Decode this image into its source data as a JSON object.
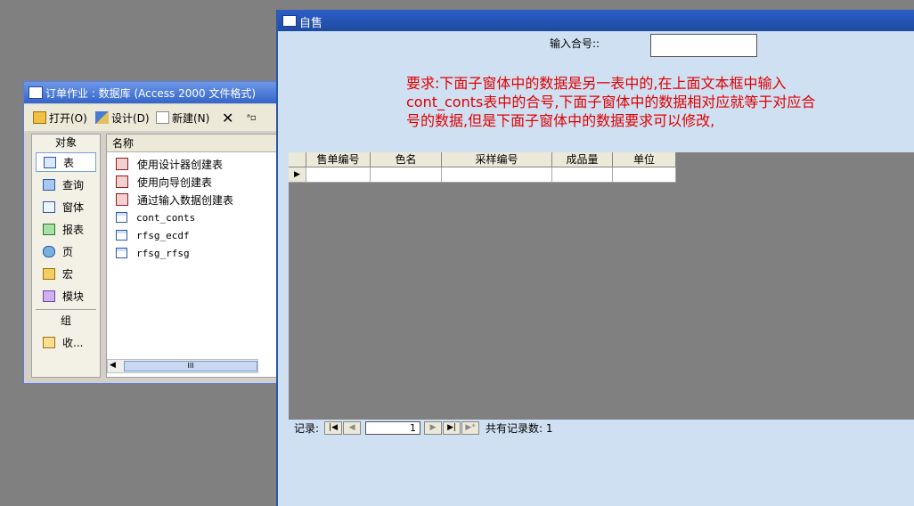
{
  "db_window": {
    "title": "订单作业 : 数据库 (Access 2000 文件格式)",
    "toolbar": {
      "open_label": "打开(O)",
      "design_label": "设计(D)",
      "new_label": "新建(N)"
    },
    "objects_header": "对象",
    "objects": [
      {
        "label": "表",
        "icon": "table-icon"
      },
      {
        "label": "查询",
        "icon": "query-icon"
      },
      {
        "label": "窗体",
        "icon": "form-icon"
      },
      {
        "label": "报表",
        "icon": "report-icon"
      },
      {
        "label": "页",
        "icon": "page-icon"
      },
      {
        "label": "宏",
        "icon": "macro-icon"
      },
      {
        "label": "模块",
        "icon": "module-icon"
      }
    ],
    "groups_header": "组",
    "favorites_label": "收...",
    "list_header": "名称",
    "list_items": [
      {
        "label": "使用设计器创建表",
        "icon": "wizard-icon"
      },
      {
        "label": "使用向导创建表",
        "icon": "wizard-icon"
      },
      {
        "label": "通过输入数据创建表",
        "icon": "wizard-icon"
      },
      {
        "label": "cont_conts",
        "icon": "table-icon"
      },
      {
        "label": "rfsg_ecdf",
        "icon": "table-icon"
      },
      {
        "label": "rfsg_rfsg",
        "icon": "table-icon"
      }
    ],
    "scrollbar_thumb": "III"
  },
  "form_window": {
    "title": "自售",
    "contract_label": "输入合号::",
    "contract_value": "",
    "requirement_text": "要求:下面子窗体中的数据是另一表中的,在上面文本框中输入cont_conts表中的合号,下面子窗体中的数据相对应就等于对应合号的数据,但是下面子窗体中的数据要求可以修改,",
    "grid_columns": [
      "售单编号",
      "色名",
      "采样编号",
      "成品量",
      "单位"
    ],
    "nav": {
      "record_label": "记录:",
      "current_record": "1",
      "total_label": "共有记录数: 1"
    }
  }
}
